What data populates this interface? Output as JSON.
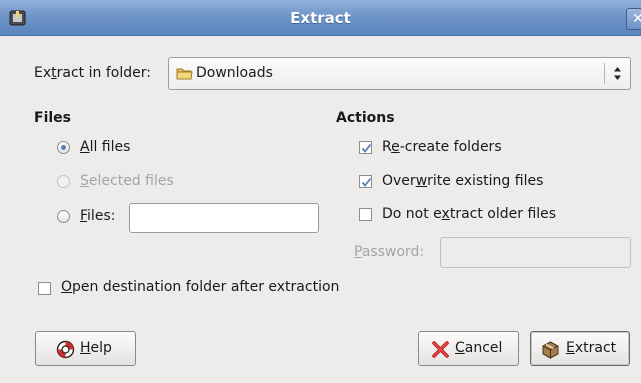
{
  "window": {
    "title": "Extract"
  },
  "colors": {
    "titlebar": "#6f95c8",
    "accent": "#5a7fb3",
    "background": "#edeceb"
  },
  "extract_in_folder": {
    "label_pre": "Ex",
    "label_mn": "t",
    "label_post": "ract in folder:",
    "value": "Downloads",
    "icon": "folder-icon"
  },
  "files": {
    "heading": "Files",
    "all_files": {
      "mn": "A",
      "rest": "ll files",
      "selected": true
    },
    "selected_files": {
      "mn": "S",
      "rest": "elected files",
      "enabled": false
    },
    "files_pattern": {
      "mn": "F",
      "rest": "iles:",
      "value": ""
    }
  },
  "actions": {
    "heading": "Actions",
    "recreate": {
      "pre": "R",
      "mn": "e",
      "post": "-create folders",
      "checked": true
    },
    "overwrite": {
      "pre": "Over",
      "mn": "w",
      "post": "rite existing files",
      "checked": true
    },
    "no_older": {
      "pre": "Do not e",
      "mn": "x",
      "post": "tract older files",
      "checked": false
    },
    "password": {
      "mn": "P",
      "rest": "assword:",
      "value": "",
      "enabled": false
    }
  },
  "open_destination": {
    "mn": "O",
    "rest": "pen destination folder after extraction",
    "checked": false
  },
  "buttons": {
    "help": {
      "mn": "H",
      "rest": "elp",
      "icon": "lifebuoy-icon"
    },
    "cancel": {
      "mn": "C",
      "rest": "ancel",
      "icon": "cancel-x-icon"
    },
    "extract": {
      "mn": "E",
      "rest": "xtract",
      "icon": "package-icon"
    }
  }
}
